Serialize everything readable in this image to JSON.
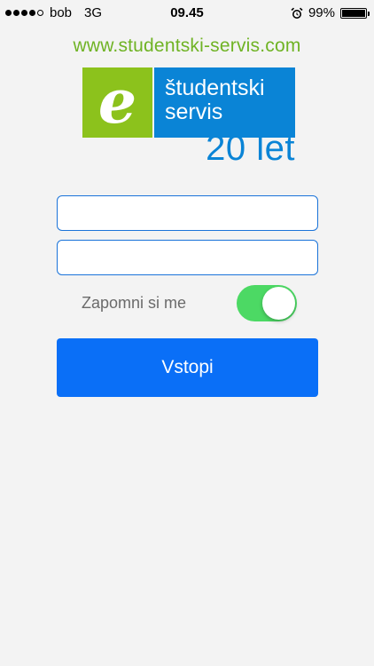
{
  "status_bar": {
    "carrier": "bob",
    "network": "3G",
    "time": "09.45",
    "battery": "99%",
    "battery_level": 0.99,
    "signal_bars": 4,
    "signal_total": 5
  },
  "header": {
    "url": "www.studentski-servis.com"
  },
  "logo": {
    "letter": "e",
    "line1": "študentski",
    "line2": "servis",
    "years": "20 let",
    "colors": {
      "green": "#8cc21c",
      "blue": "#0a84d6"
    }
  },
  "form": {
    "username_value": "",
    "password_value": "",
    "remember_label": "Zapomni si me",
    "remember_on": true,
    "submit_label": "Vstopi"
  },
  "colors": {
    "url_green": "#6fb324",
    "toggle_on": "#4cd964",
    "button_blue": "#0a6ff7",
    "field_border": "#1a73d9"
  }
}
